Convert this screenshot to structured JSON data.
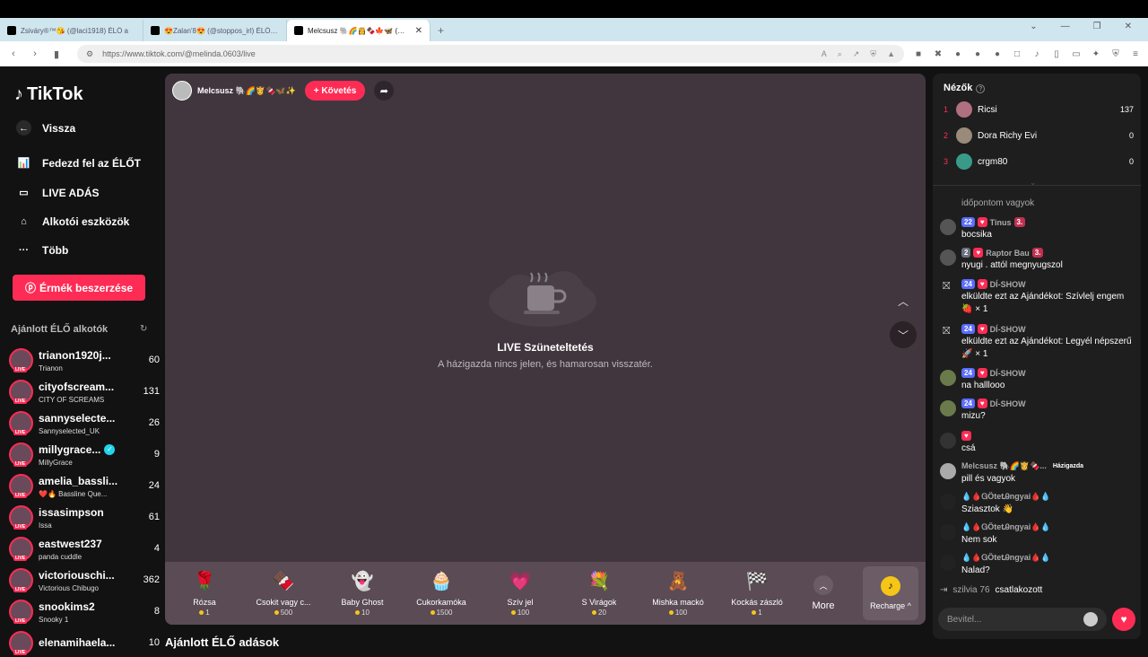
{
  "browser": {
    "tabs": [
      {
        "title": "Zsiváry®™😘 (@laci1918) ÉLŐ a"
      },
      {
        "title": "😍Zalan'8😍 (@stoppos_irl) ÉLŐ ad"
      },
      {
        "title": "Melcsusz 🐘🌈👸🍫🍁🦋 (@m"
      }
    ],
    "url": "https://www.tiktok.com/@melinda.0603/live"
  },
  "sidebar": {
    "logo": "TikTok",
    "nav": [
      {
        "label": "Vissza",
        "icon": "back-arrow-icon"
      },
      {
        "label": "Fedezd fel az ÉLŐT",
        "icon": "explore-icon"
      },
      {
        "label": "LIVE ADÁS",
        "icon": "camera-icon"
      },
      {
        "label": "Alkotói eszközök",
        "icon": "creator-tools-icon"
      },
      {
        "label": "Több",
        "icon": "more-icon"
      }
    ],
    "coins_button": "Érmék beszerzése",
    "recommended_title": "Ajánlott ÉLŐ alkotók",
    "creators": [
      {
        "name": "trianon1920j...",
        "sub": "Trianon",
        "count": "60"
      },
      {
        "name": "cityofscream...",
        "sub": "CITY OF SCREAMS",
        "count": "131"
      },
      {
        "name": "sannyselecte...",
        "sub": "Sannyselected_UK",
        "count": "26"
      },
      {
        "name": "millygrace...",
        "sub": "MillyGrace",
        "count": "9",
        "verified": true
      },
      {
        "name": "amelia_bassli...",
        "sub": "❤️🔥 Bassline Que...",
        "count": "24"
      },
      {
        "name": "issasimpson",
        "sub": "Issa",
        "count": "61"
      },
      {
        "name": "eastwest237",
        "sub": "panda cuddle",
        "count": "4"
      },
      {
        "name": "victoriouschi...",
        "sub": "Victorious Chibugo",
        "count": "362"
      },
      {
        "name": "snookims2",
        "sub": "Snooky 1",
        "count": "8"
      },
      {
        "name": "elenamihaela...",
        "sub": "",
        "count": "10"
      }
    ]
  },
  "stage": {
    "host_name": "Melcsusz 🐘🌈👸🍫🦋✨",
    "follow_label": "+ Követés",
    "pause_title": "LIVE Szüneteltetés",
    "pause_sub": "A házigazda nincs jelen, és hamarosan visszatér.",
    "gifts": [
      {
        "name": "Rózsa",
        "price": "1",
        "icon": "🌹"
      },
      {
        "name": "Csokit vagy c...",
        "price": "500",
        "icon": "🍫"
      },
      {
        "name": "Baby Ghost",
        "price": "10",
        "icon": "👻"
      },
      {
        "name": "Cukorkamóka",
        "price": "1500",
        "icon": "🧁"
      },
      {
        "name": "Szív jel",
        "price": "100",
        "icon": "💗"
      },
      {
        "name": "S Virágok",
        "price": "20",
        "icon": "💐"
      },
      {
        "name": "Mishka mackó",
        "price": "100",
        "icon": "🧸"
      },
      {
        "name": "Kockás zászló",
        "price": "1",
        "icon": "🏁"
      }
    ],
    "more_label": "More",
    "recharge_label": "Recharge ^",
    "recommended_live_title": "Ajánlott ÉLŐ adások"
  },
  "panel": {
    "viewers_title": "Nézők",
    "viewers": [
      {
        "rank": "1",
        "name": "Ricsi",
        "count": "137"
      },
      {
        "rank": "2",
        "name": "Dora Richy Evi",
        "count": "0"
      },
      {
        "rank": "3",
        "name": "crgm80",
        "count": "0"
      }
    ],
    "messages": [
      {
        "user": "",
        "text": "időpontom vagyok",
        "badges": []
      },
      {
        "user": "Tinus",
        "text": "bocsika",
        "badges": [
          "22",
          "3."
        ]
      },
      {
        "user": "Raptor Bau",
        "text": "nyugi . attól megnyugszol",
        "badges": [
          "2",
          "3."
        ]
      },
      {
        "user": "DÍ-SHOW",
        "text": "elküldte ezt az Ajándékot: Szívlelj engem 🍓 × 1",
        "badges": [
          "24"
        ],
        "gift": true
      },
      {
        "user": "DÍ-SHOW",
        "text": "elküldte ezt az Ajándékot: Legyél népszerű 🚀 × 1",
        "badges": [
          "24"
        ],
        "gift": true
      },
      {
        "user": "DÍ-SHOW",
        "text": "na halllooo",
        "badges": [
          "24"
        ]
      },
      {
        "user": "DÍ-SHOW",
        "text": "mizu?",
        "badges": [
          "24"
        ]
      },
      {
        "user": "",
        "text": "csá",
        "badges": []
      },
      {
        "user": "Melcsusz 🐘🌈👸🍫...",
        "text": "pill és vagyok",
        "badges": [],
        "host_tag": "Házigazda"
      },
      {
        "user": "💧🩸ᏀÖtetᎯngyai🩸💧",
        "text": "Sziasztok 👋",
        "badges": []
      },
      {
        "user": "💧🩸ᏀÖtetᎯngyai🩸💧",
        "text": "Nem sok",
        "badges": []
      },
      {
        "user": "💧🩸ᏀÖtetᎯngyai🩸💧",
        "text": "Nalad?",
        "badges": []
      }
    ],
    "joined_name": "szilvia 76",
    "joined_text": "csatlakozott",
    "input_placeholder": "Bevitel..."
  }
}
